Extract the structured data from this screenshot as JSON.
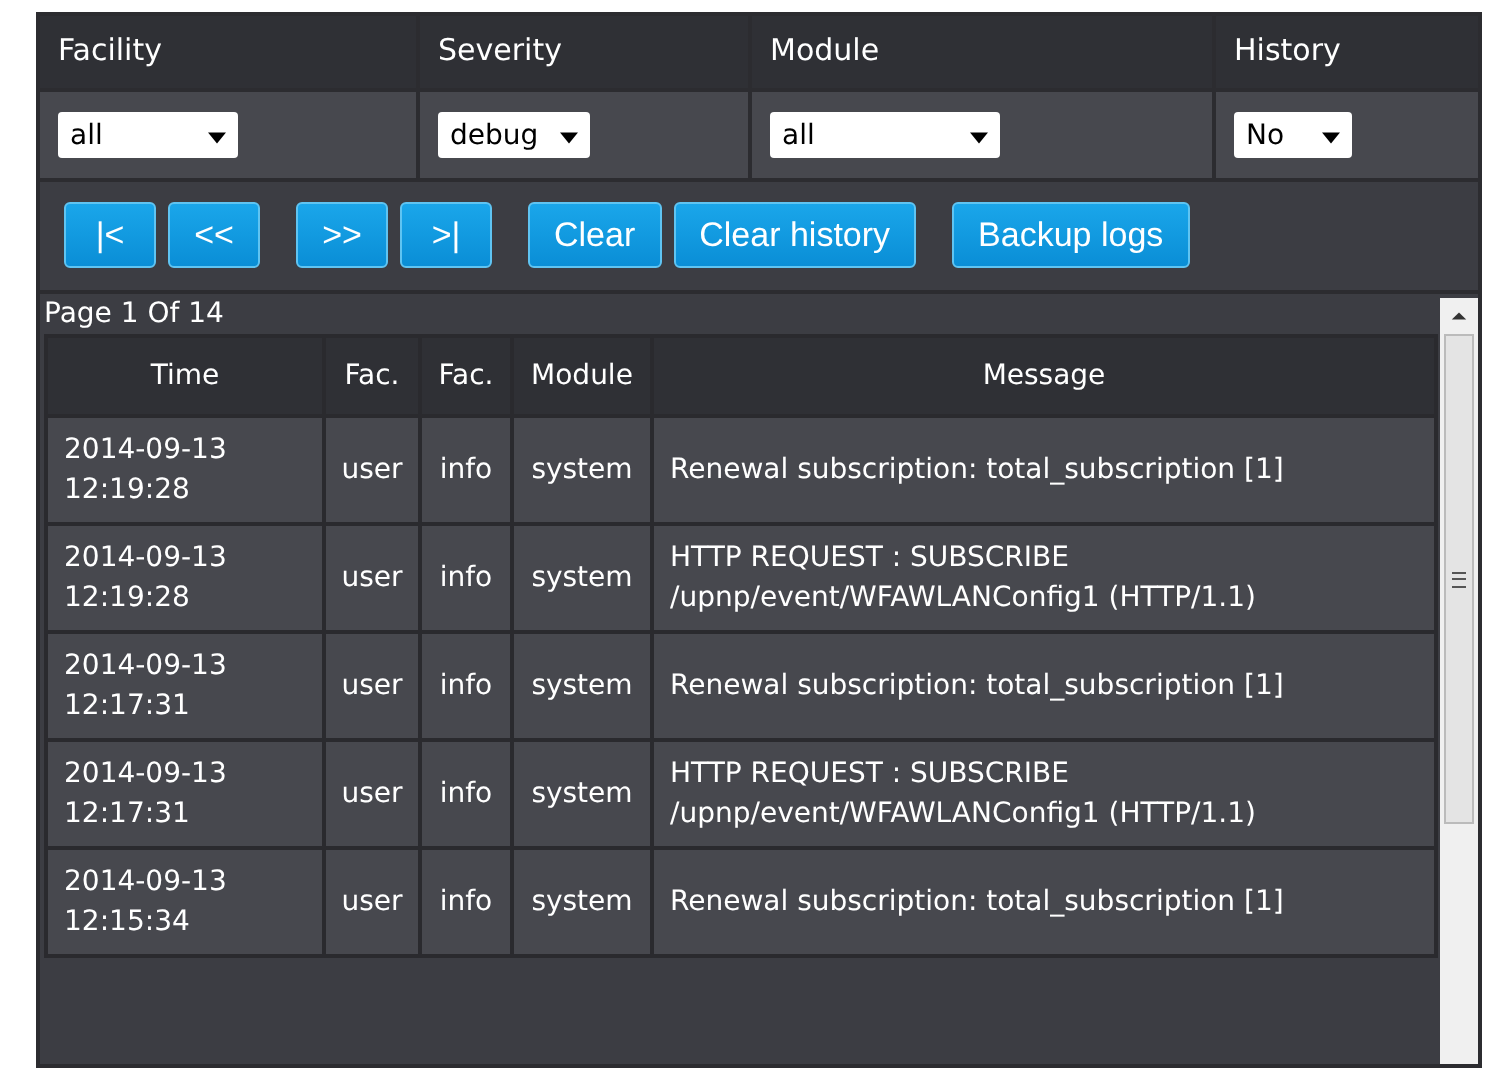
{
  "filters": [
    {
      "label": "Facility",
      "value": "all"
    },
    {
      "label": "Severity",
      "value": "debug"
    },
    {
      "label": "Module",
      "value": "all"
    },
    {
      "label": "History",
      "value": "No"
    }
  ],
  "buttons": [
    "|<",
    "<<",
    ">>",
    ">|",
    "Clear",
    "Clear history",
    "Backup logs"
  ],
  "page_info": "Page 1 Of 14",
  "table": {
    "columns": [
      "Time",
      "Fac.",
      "Fac.",
      "Module",
      "Message"
    ],
    "rows": [
      [
        "2014-09-13 12:19:28",
        "user",
        "info",
        "system",
        "Renewal subscription: total_subscription [1]"
      ],
      [
        "2014-09-13 12:19:28",
        "user",
        "info",
        "system",
        "HTTP REQUEST : SUBSCRIBE /upnp/event/WFAWLANConfig1 (HTTP/1.1)"
      ],
      [
        "2014-09-13 12:17:31",
        "user",
        "info",
        "system",
        "Renewal subscription: total_subscription [1]"
      ],
      [
        "2014-09-13 12:17:31",
        "user",
        "info",
        "system",
        "HTTP REQUEST : SUBSCRIBE /upnp/event/WFAWLANConfig1 (HTTP/1.1)"
      ],
      [
        "2014-09-13 12:15:34",
        "user",
        "info",
        "system",
        "Renewal subscription: total_subscription [1]"
      ]
    ]
  }
}
